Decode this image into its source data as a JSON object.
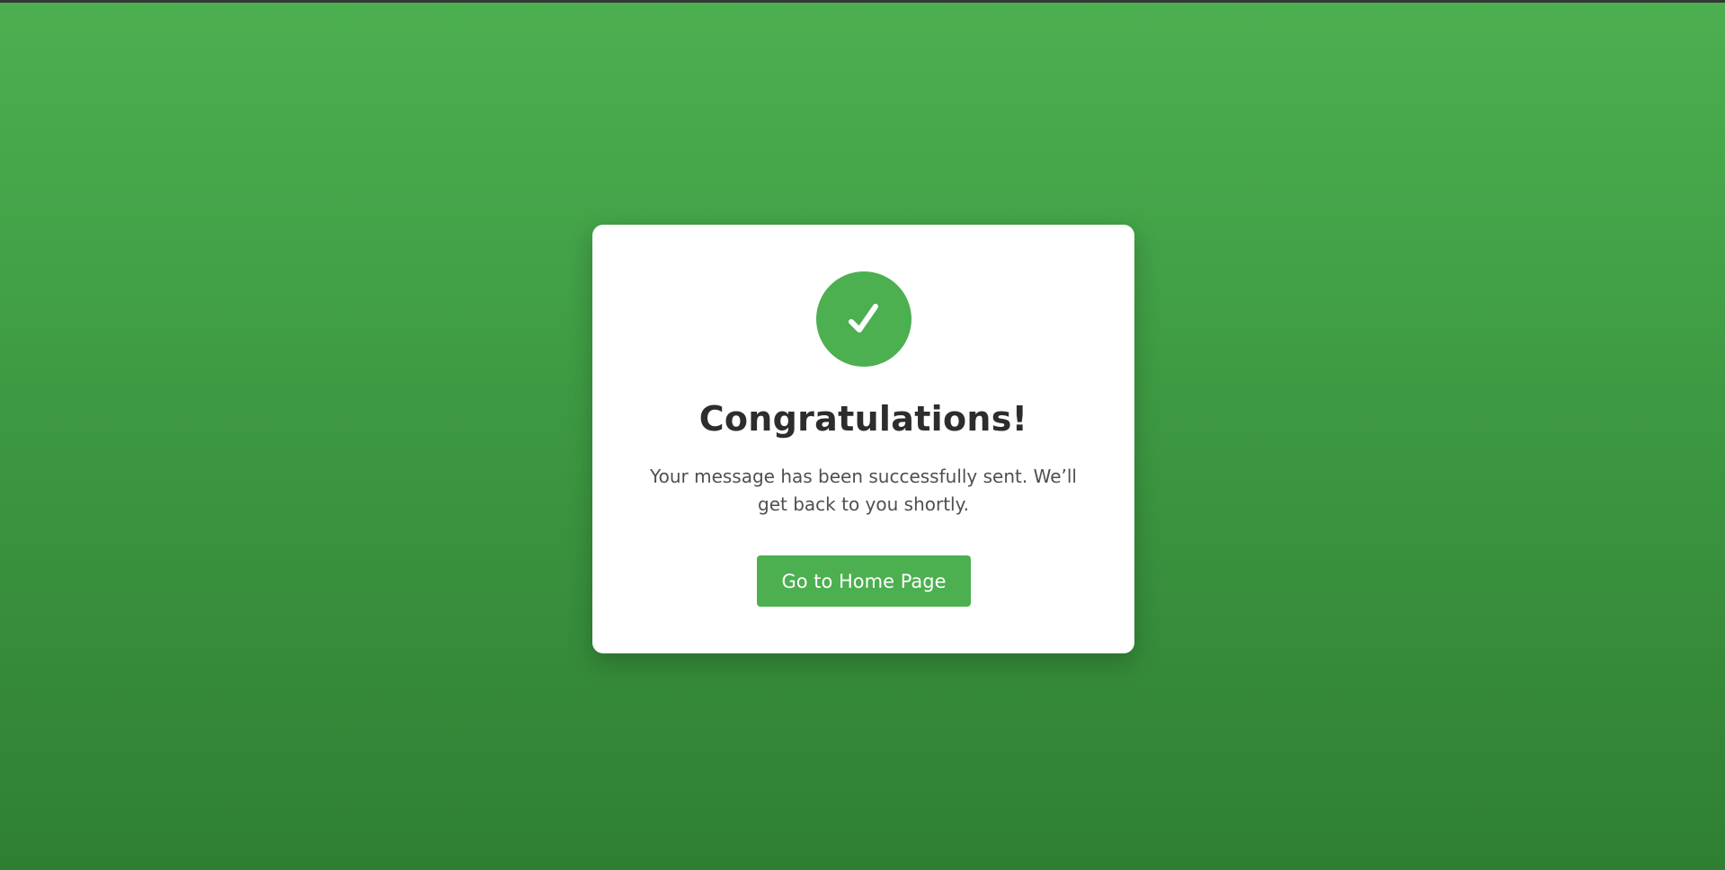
{
  "theme": {
    "accent": "#4caf50",
    "background_top": "#4caf50",
    "background_bottom": "#2f7f33",
    "card_background": "#ffffff",
    "title_color": "#2d2d2d",
    "text_color": "#4f4f4f"
  },
  "card": {
    "icon": "check-icon",
    "title": "Congratulations!",
    "message": "Your message has been successfully sent. We’ll get back to you shortly.",
    "button_label": "Go to Home Page"
  }
}
